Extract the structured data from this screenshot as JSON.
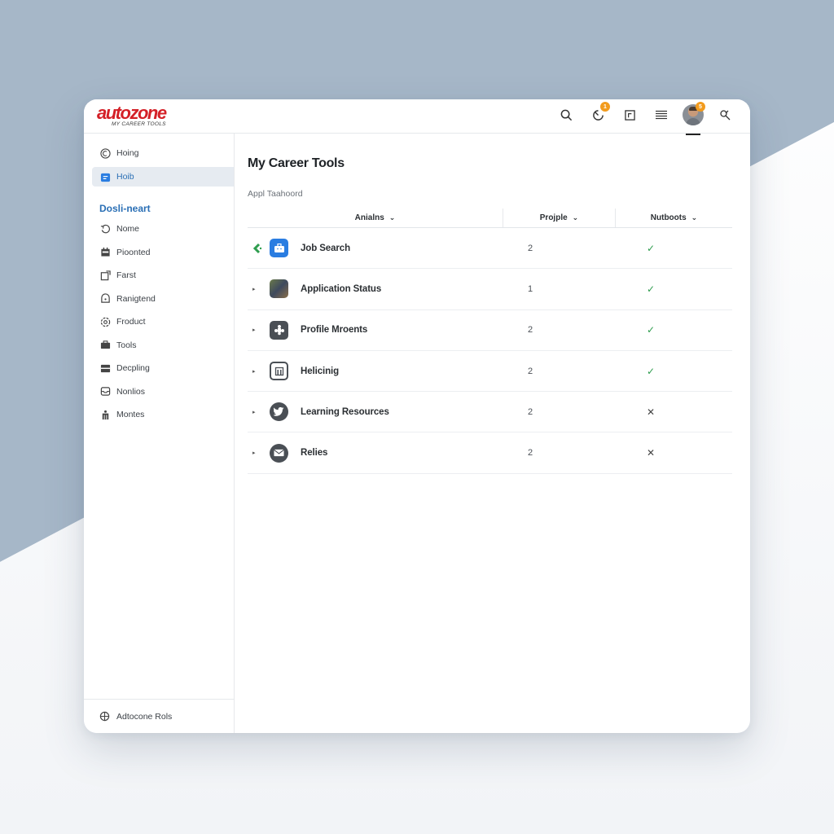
{
  "app": {
    "logo_text": "autozone",
    "logo_subtitle": "MY CAREER TOOLS",
    "brand_color": "#d42027",
    "accent_color": "#2a6fb5"
  },
  "topbar": {
    "icons": [
      {
        "name": "search-icon"
      },
      {
        "name": "notifications-icon",
        "badge": "1"
      },
      {
        "name": "window-icon"
      },
      {
        "name": "menu-icon"
      },
      {
        "name": "avatar",
        "badge": "5"
      },
      {
        "name": "tools-icon"
      }
    ]
  },
  "sidebar": {
    "top_items": [
      {
        "label": "Hoing",
        "icon": "back-circle-icon",
        "active": false
      },
      {
        "label": "Hoib",
        "icon": "briefcase-icon",
        "active": true
      }
    ],
    "section_title": "Dosli-neart",
    "items": [
      {
        "label": "Nome",
        "icon": "refresh-icon"
      },
      {
        "label": "Pioonted",
        "icon": "calendar-icon"
      },
      {
        "label": "Farst",
        "icon": "export-icon"
      },
      {
        "label": "Ranigtend",
        "icon": "dashboard-icon"
      },
      {
        "label": "Froduct",
        "icon": "settings-icon"
      },
      {
        "label": "Tools",
        "icon": "toolbox-icon"
      },
      {
        "label": "Decpling",
        "icon": "card-icon"
      },
      {
        "label": "Nonlios",
        "icon": "inbox-icon"
      },
      {
        "label": "Montes",
        "icon": "people-icon"
      }
    ],
    "footer_label": "Adtocone Rols"
  },
  "main": {
    "title": "My Career Tools",
    "subtitle": "Appl Taahoord",
    "table": {
      "columns": [
        {
          "label": "Anialns"
        },
        {
          "label": "Projple"
        },
        {
          "label": "Nutboots"
        }
      ],
      "rows": [
        {
          "label": "Job Search",
          "count": "2",
          "status": "check",
          "status_glyph": "✓",
          "icon": "job-search-icon",
          "expander": "back-arrow"
        },
        {
          "label": "Application Status",
          "count": "1",
          "status": "check",
          "status_glyph": "✓",
          "icon": "photo-icon",
          "expander": "▸"
        },
        {
          "label": "Profile Mroents",
          "count": "2",
          "status": "check",
          "status_glyph": "✓",
          "icon": "puzzle-icon",
          "expander": "▸"
        },
        {
          "label": "Helicinig",
          "count": "2",
          "status": "check",
          "status_glyph": "✓",
          "icon": "building-icon",
          "expander": "▸"
        },
        {
          "label": "Learning Resources",
          "count": "2",
          "status": "cross",
          "status_glyph": "✕",
          "icon": "bird-icon",
          "expander": "▸"
        },
        {
          "label": "Relies",
          "count": "2",
          "status": "cross",
          "status_glyph": "✕",
          "icon": "mail-icon",
          "expander": "▸"
        }
      ]
    }
  }
}
